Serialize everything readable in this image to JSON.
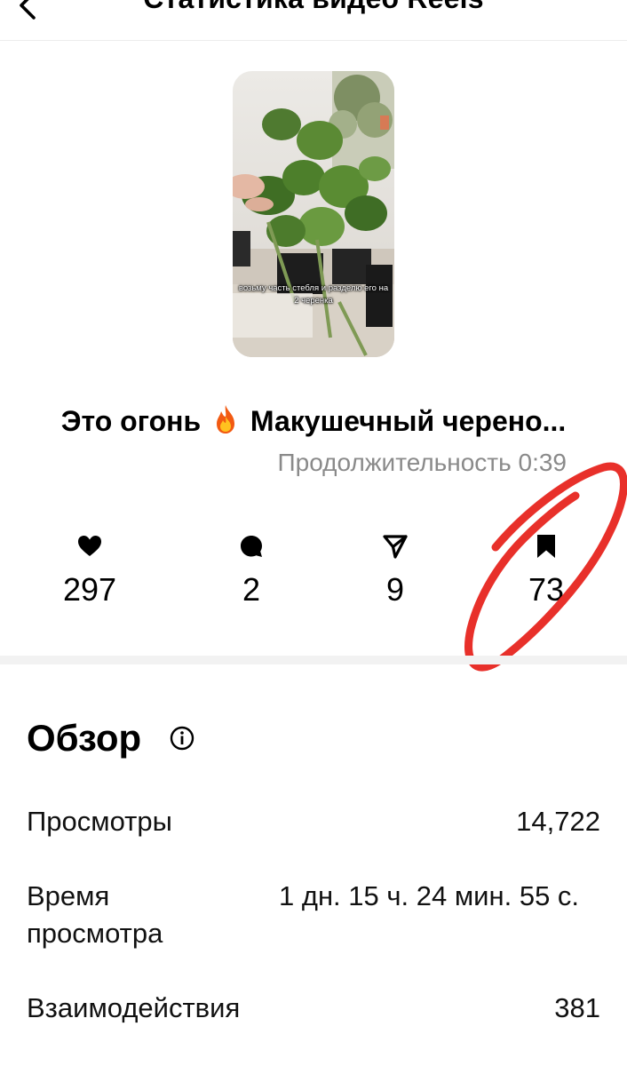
{
  "header": {
    "title": "Статистика видео Reels",
    "back_icon": "chevron-left-icon"
  },
  "reel": {
    "caption": "возьму часть стебля и разделю его на 2 черенка",
    "title_before": "Это огонь",
    "title_emoji_icon": "fire-icon",
    "title_after": "Макушечный черено...",
    "duration": "Продолжительность 0:39"
  },
  "stats": [
    {
      "icon": "heart-icon",
      "value": "297"
    },
    {
      "icon": "comment-icon",
      "value": "2"
    },
    {
      "icon": "share-icon",
      "value": "9"
    },
    {
      "icon": "bookmark-icon",
      "value": "73"
    }
  ],
  "annotation": {
    "color": "#e8302a",
    "shape": "hand-drawn circle around saves count"
  },
  "overview": {
    "heading": "Обзор",
    "info_icon": "info-icon",
    "rows": {
      "views": {
        "label": "Просмотры",
        "value": "14,722"
      },
      "watch_time": {
        "label": "Время просмотра",
        "value": "1 дн. 15 ч. 24 мин. 55 с."
      },
      "interactions": {
        "label": "Взаимодействия",
        "value": "381"
      }
    }
  }
}
